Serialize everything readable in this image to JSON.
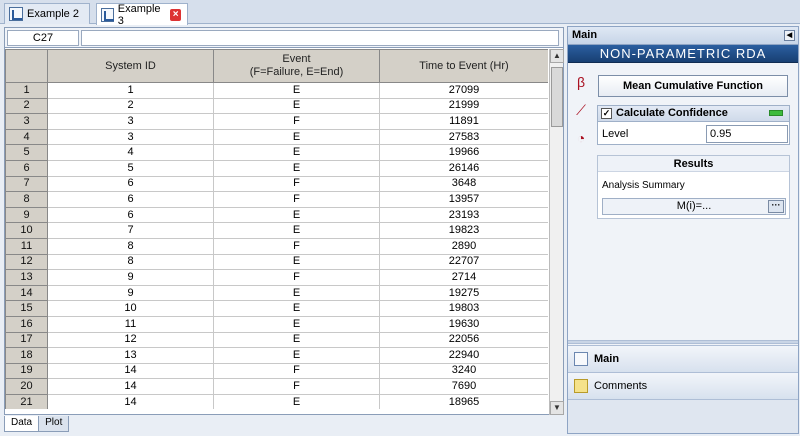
{
  "tabs": [
    {
      "label": "Example 2",
      "active": false
    },
    {
      "label": "Example 3",
      "active": true
    }
  ],
  "cell_reference": "C27",
  "formula_value": "",
  "columns": [
    "System ID",
    "Event\n(F=Failure, E=End)",
    "Time to Event (Hr)"
  ],
  "rows": [
    [
      "1",
      "1",
      "E",
      "27099"
    ],
    [
      "2",
      "2",
      "E",
      "21999"
    ],
    [
      "3",
      "3",
      "F",
      "11891"
    ],
    [
      "4",
      "3",
      "E",
      "27583"
    ],
    [
      "5",
      "4",
      "E",
      "19966"
    ],
    [
      "6",
      "5",
      "E",
      "26146"
    ],
    [
      "7",
      "6",
      "F",
      "3648"
    ],
    [
      "8",
      "6",
      "F",
      "13957"
    ],
    [
      "9",
      "6",
      "E",
      "23193"
    ],
    [
      "10",
      "7",
      "E",
      "19823"
    ],
    [
      "11",
      "8",
      "F",
      "2890"
    ],
    [
      "12",
      "8",
      "E",
      "22707"
    ],
    [
      "13",
      "9",
      "F",
      "2714"
    ],
    [
      "14",
      "9",
      "E",
      "19275"
    ],
    [
      "15",
      "10",
      "E",
      "19803"
    ],
    [
      "16",
      "11",
      "E",
      "19630"
    ],
    [
      "17",
      "12",
      "E",
      "22056"
    ],
    [
      "18",
      "13",
      "E",
      "22940"
    ],
    [
      "19",
      "14",
      "F",
      "3240"
    ],
    [
      "20",
      "14",
      "F",
      "7690"
    ],
    [
      "21",
      "14",
      "E",
      "18965"
    ]
  ],
  "sheet_tabs": [
    {
      "label": "Data",
      "active": true
    },
    {
      "label": "Plot",
      "active": false
    }
  ],
  "panel": {
    "header": "Main",
    "banner": "NON-PARAMETRIC RDA",
    "method_label": "Mean Cumulative Function",
    "confidence_label": "Calculate Confidence",
    "confidence_checked": "✓",
    "level_label": "Level",
    "level_value": "0.95",
    "results_label": "Results",
    "summary_label": "Analysis Summary",
    "summary_value": "M(i)=...",
    "ellipsis": "···",
    "nav_main": "Main",
    "nav_comments": "Comments"
  },
  "colors": {
    "banner": "#1f4b86",
    "confidence_indicator": "#3dbb3d",
    "close_tab": "#dd3333"
  }
}
